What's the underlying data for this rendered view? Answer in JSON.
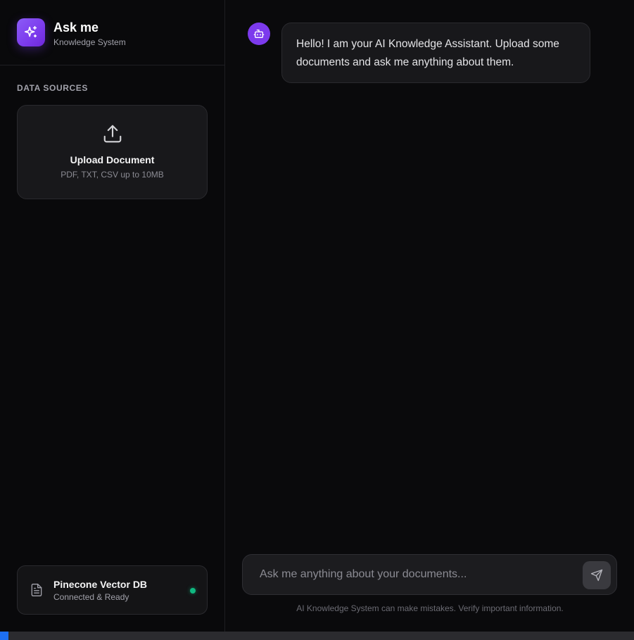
{
  "app": {
    "title": "Ask me",
    "subtitle": "Knowledge System"
  },
  "sidebar": {
    "section_label": "DATA SOURCES",
    "upload": {
      "title": "Upload Document",
      "hint": "PDF, TXT, CSV up to 10MB",
      "icon": "upload-icon"
    },
    "database": {
      "name": "Pinecone Vector DB",
      "status": "Connected & Ready",
      "icon": "document-icon",
      "status_color": "#10b981"
    }
  },
  "chat": {
    "messages": [
      {
        "role": "assistant",
        "avatar_icon": "bot-icon",
        "text": "Hello! I am your AI Knowledge Assistant. Upload some documents and ask me anything about them."
      }
    ],
    "input": {
      "placeholder": "Ask me anything about your documents...",
      "value": ""
    },
    "send_icon": "send-icon",
    "disclaimer": "AI Knowledge System can make mistakes. Verify important information."
  },
  "colors": {
    "accent": "#7c3aed",
    "background": "#09090b",
    "status_ok": "#10b981"
  }
}
